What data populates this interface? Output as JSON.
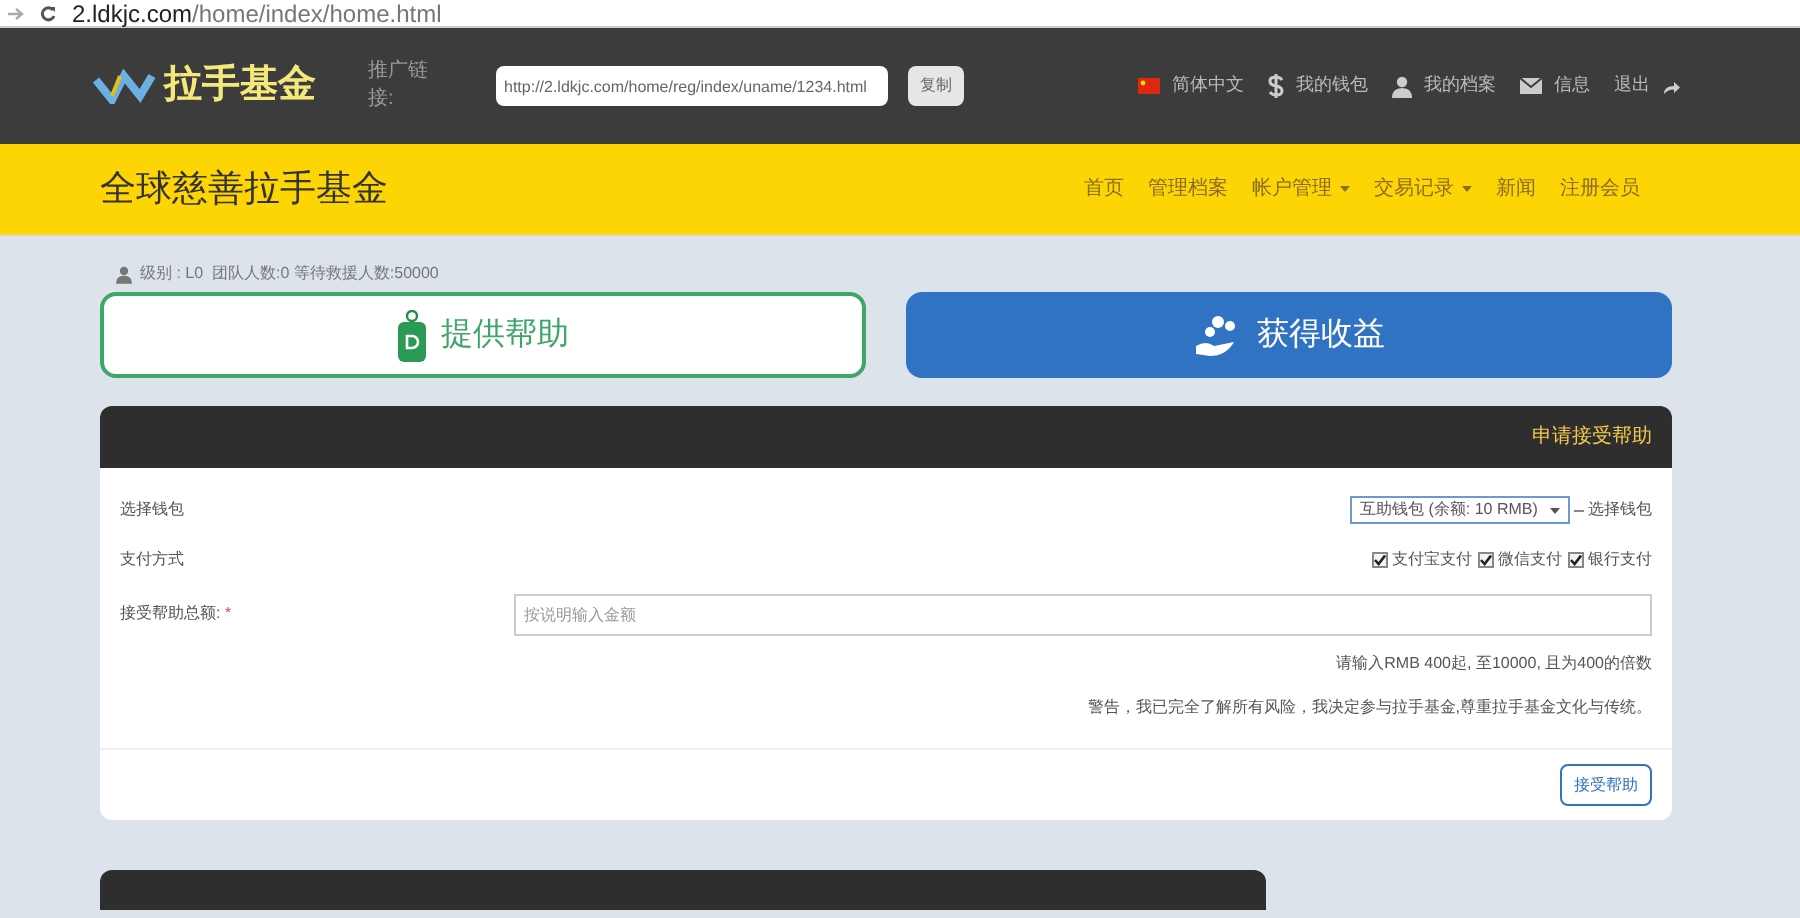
{
  "browser": {
    "url_host": "2.ldkjc.com",
    "url_path": "/home/index/home.html"
  },
  "header": {
    "logo": "拉手基金",
    "promo_label": "推广链接:",
    "promo_link": "http://2.ldkjc.com/home/reg/index/uname/1234.html",
    "copy_button": "复制",
    "links": [
      {
        "kind": "flag",
        "label": "简体中文"
      },
      {
        "kind": "dollar",
        "label": "我的钱包"
      },
      {
        "kind": "user",
        "label": "我的档案"
      },
      {
        "kind": "mail",
        "label": "信息"
      },
      {
        "kind": "logout",
        "label": "退出"
      }
    ]
  },
  "nav": {
    "title": "全球慈善拉手基金",
    "items": [
      {
        "label": "首页",
        "dropdown": false
      },
      {
        "label": "管理档案",
        "dropdown": false
      },
      {
        "label": "帐户管理",
        "dropdown": true
      },
      {
        "label": "交易记录",
        "dropdown": true
      },
      {
        "label": "新闻",
        "dropdown": false
      },
      {
        "label": "注册会员",
        "dropdown": false
      }
    ]
  },
  "user_stats": "级别 : L0  团队人数:0 等待救援人数:50000",
  "actions": [
    {
      "kind": "provide",
      "label": "提供帮助"
    },
    {
      "kind": "receive",
      "label": "获得收益"
    }
  ],
  "form": {
    "title": "申请接受帮助",
    "wallet_label": "选择钱包",
    "wallet_value": "互助钱包 (余额: 10 RMB)",
    "wallet_hint": "选择钱包",
    "payment_label": "支付方式",
    "payments": [
      {
        "label": "支付宝支付",
        "checked": true
      },
      {
        "label": "微信支付",
        "checked": true
      },
      {
        "label": "银行支付",
        "checked": true
      }
    ],
    "amount_label": "接受帮助总额:",
    "required_mark": "*",
    "amount_placeholder": "按说明输入金额",
    "amount_hint": "请输入RMB 400起, 至10000, 且为400的倍数",
    "warning": "警告，我已完全了解所有风险，我决定参与拉手基金,尊重拉手基金文化与传统。",
    "submit": "接受帮助"
  }
}
